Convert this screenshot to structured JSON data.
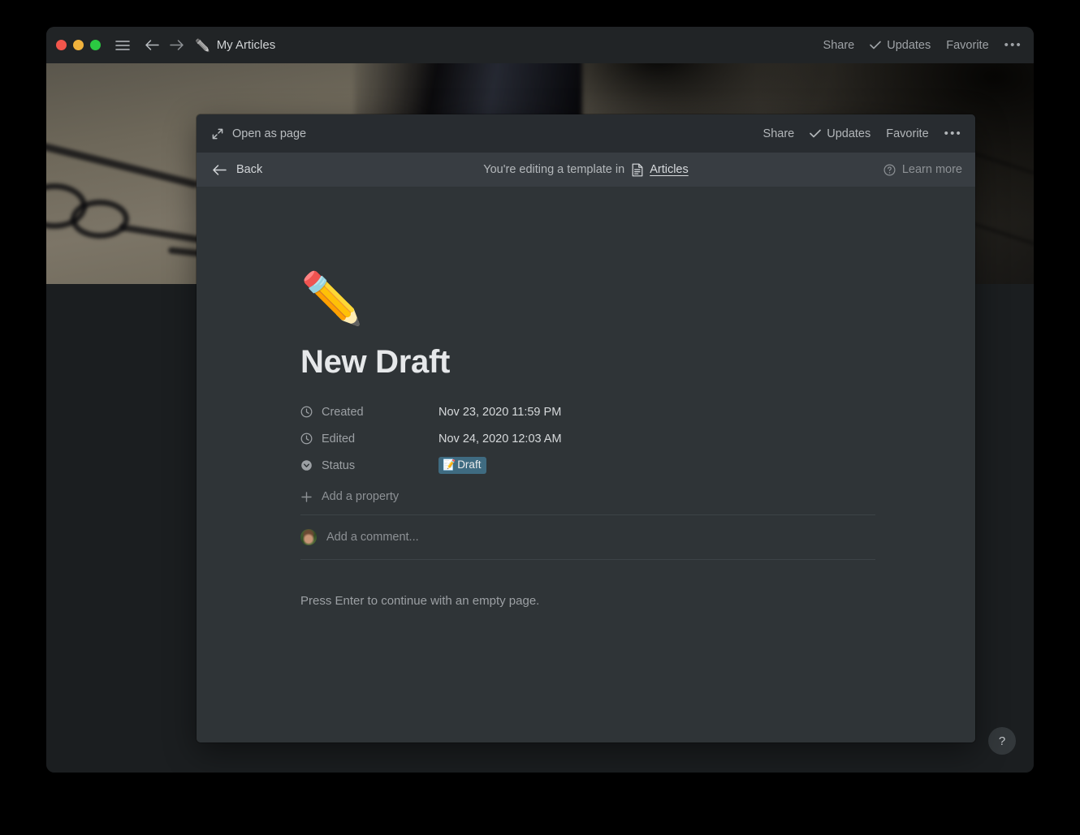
{
  "window": {
    "titlebar": {
      "traffic_lights": [
        "close",
        "minimize",
        "zoom"
      ],
      "menu_icon": "hamburger-icon",
      "back_icon": "arrow-left-icon",
      "forward_icon": "arrow-right-icon",
      "page_icon": "pencil-emoji",
      "page_title": "My Articles",
      "actions": {
        "share": "Share",
        "updates": "Updates",
        "favorite": "Favorite",
        "more": "•••"
      }
    },
    "help_button": "?"
  },
  "modal": {
    "topbar": {
      "open_as_page": "Open as page",
      "open_as_page_icon": "expand-diagonal-icon",
      "share": "Share",
      "updates": "Updates",
      "updates_icon": "check-icon",
      "favorite": "Favorite",
      "more": "•••"
    },
    "template_bar": {
      "back": "Back",
      "back_icon": "arrow-left-icon",
      "notice_prefix": "You're editing a template in",
      "database_icon": "document-icon",
      "database_name": "Articles",
      "learn_more": "Learn more",
      "learn_more_icon": "question-circle-icon"
    },
    "page": {
      "emoji": "✏️",
      "title": "New Draft",
      "properties": [
        {
          "icon": "clock-icon",
          "key": "Created",
          "value": "Nov 23, 2020 11:59 PM",
          "type": "text"
        },
        {
          "icon": "clock-icon",
          "key": "Edited",
          "value": "Nov 24, 2020 12:03 AM",
          "type": "text"
        },
        {
          "icon": "select-icon",
          "key": "Status",
          "value": "Draft",
          "value_emoji": "📝",
          "type": "select"
        }
      ],
      "add_property": "Add a property",
      "add_property_icon": "plus-icon",
      "comment_placeholder": "Add a comment...",
      "empty_hint": "Press Enter to continue with an empty page."
    }
  },
  "colors": {
    "window_bg": "#1b1e20",
    "titlebar_bg": "#212426",
    "modal_bg": "#2f3437",
    "modal_topbar_bg": "#282c30",
    "template_bar_bg": "#383d42",
    "status_pill_bg": "#3f6b81",
    "text_primary": "#e6e8ea",
    "text_secondary": "#9ca0a4",
    "traffic_red": "#f2564c",
    "traffic_yellow": "#f0b23c",
    "traffic_green": "#2bc942"
  }
}
